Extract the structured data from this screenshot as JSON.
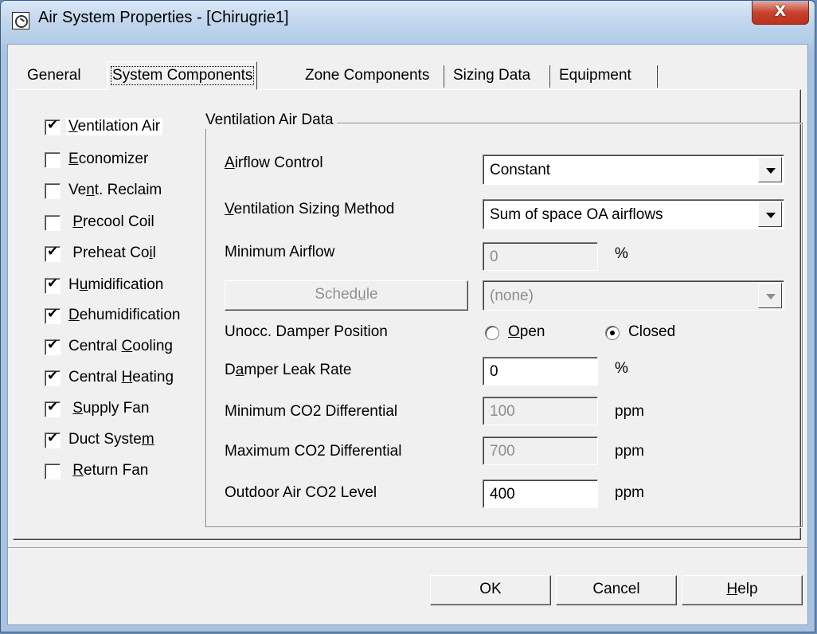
{
  "window": {
    "title": "Air System Properties - [Chirugrie1]",
    "close_symbol": "X"
  },
  "tabs": [
    {
      "label": "General",
      "active": false
    },
    {
      "label": "System Components",
      "active": true
    },
    {
      "label": "Zone Components",
      "active": false
    },
    {
      "label": "Sizing Data",
      "active": false
    },
    {
      "label": "Equipment",
      "active": false
    }
  ],
  "components": [
    {
      "pre": "",
      "u": "V",
      "post": "entilation Air",
      "checked": true
    },
    {
      "pre": "",
      "u": "E",
      "post": "conomizer",
      "checked": false
    },
    {
      "pre": "Ve",
      "u": "n",
      "post": "t. Reclaim",
      "checked": false
    },
    {
      "pre": " ",
      "u": "P",
      "post": "recool Coil",
      "checked": false
    },
    {
      "pre": " Preheat Co",
      "u": "i",
      "post": "l",
      "checked": true
    },
    {
      "pre": "H",
      "u": "u",
      "post": "midification",
      "checked": true
    },
    {
      "pre": "",
      "u": "D",
      "post": "ehumidification",
      "checked": true
    },
    {
      "pre": "Central ",
      "u": "C",
      "post": "ooling",
      "checked": true
    },
    {
      "pre": "Central ",
      "u": "H",
      "post": "eating",
      "checked": true
    },
    {
      "pre": " ",
      "u": "S",
      "post": "upply Fan",
      "checked": true
    },
    {
      "pre": "Duct Syste",
      "u": "m",
      "post": "",
      "checked": true
    },
    {
      "pre": " ",
      "u": "R",
      "post": "eturn Fan",
      "checked": false
    }
  ],
  "ventilation": {
    "group_title": "Ventilation Air Data",
    "airflow_control": {
      "pre": "",
      "u": "A",
      "post": "irflow Control",
      "value": "Constant"
    },
    "sizing_method": {
      "pre": "",
      "u": "V",
      "post": "entilation Sizing Method",
      "value": "Sum of space OA airflows"
    },
    "minimum_airflow": {
      "label": "Minimum Airflow",
      "value": "0",
      "unit": "%"
    },
    "schedule": {
      "pre": "Sched",
      "u": "u",
      "post": "le",
      "value": "(none)"
    },
    "unocc_damper": {
      "label": "Unocc. Damper Position",
      "open_u": "O",
      "open_post": "pen",
      "closed_label": "Closed",
      "selected": "Closed"
    },
    "damper_leak": {
      "pre": "D",
      "u": "a",
      "post": "mper Leak Rate",
      "value": "0",
      "unit": "%"
    },
    "min_co2": {
      "label": "Minimum CO2 Differential",
      "value": "100",
      "unit": "ppm"
    },
    "max_co2": {
      "label": "Maximum CO2 Differential",
      "value": "700",
      "unit": "ppm"
    },
    "outdoor_co2": {
      "label": "Outdoor Air CO2 Level",
      "value": "400",
      "unit": "ppm"
    }
  },
  "buttons": {
    "ok": "OK",
    "cancel": "Cancel",
    "help_u": "H",
    "help_post": "elp"
  }
}
